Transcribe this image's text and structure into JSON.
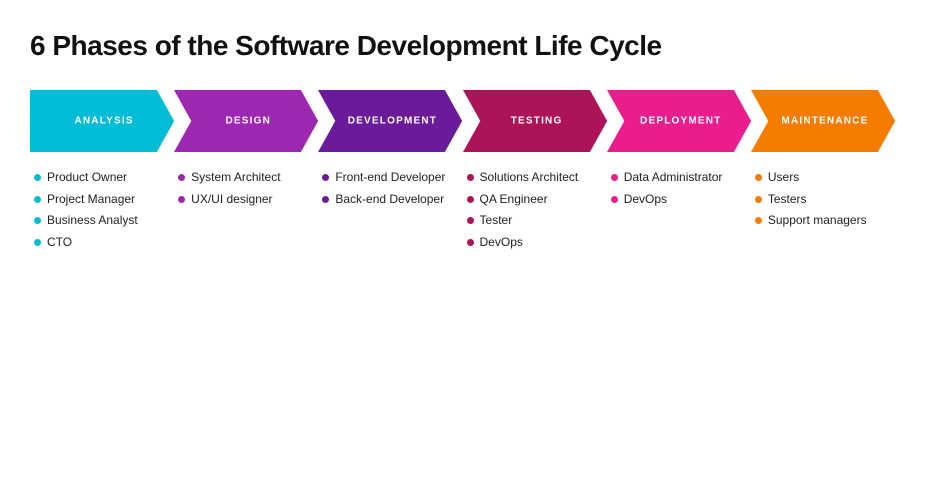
{
  "title": "6 Phases of the Software Development Life Cycle",
  "phases": [
    {
      "id": "analysis",
      "label": "ANALYSIS",
      "color": "#00BCD4",
      "dot_color": "#00BCD4",
      "roles": [
        "Product Owner",
        "Project Manager",
        "Business Analyst",
        "CTO"
      ]
    },
    {
      "id": "design",
      "label": "DESIGN",
      "color": "#9C27B0",
      "dot_color": "#9C27B0",
      "roles": [
        "System Architect",
        "UX/UI designer"
      ]
    },
    {
      "id": "development",
      "label": "DEVELOPMENT",
      "color": "#6A1B9A",
      "dot_color": "#6A1B9A",
      "roles": [
        "Front-end Developer",
        "Back-end Developer"
      ]
    },
    {
      "id": "testing",
      "label": "TESTING",
      "color": "#AD1457",
      "dot_color": "#AD1457",
      "roles": [
        "Solutions Architect",
        "QA Engineer",
        "Tester",
        "DevOps"
      ]
    },
    {
      "id": "deployment",
      "label": "DEPLOYMENT",
      "color": "#E91E8C",
      "dot_color": "#E91E8C",
      "roles": [
        "Data Administrator",
        "DevOps"
      ]
    },
    {
      "id": "maintenance",
      "label": "MAINTENANCE",
      "color": "#F57C00",
      "dot_color": "#F57C00",
      "roles": [
        "Users",
        "Testers",
        "Support managers"
      ]
    }
  ]
}
